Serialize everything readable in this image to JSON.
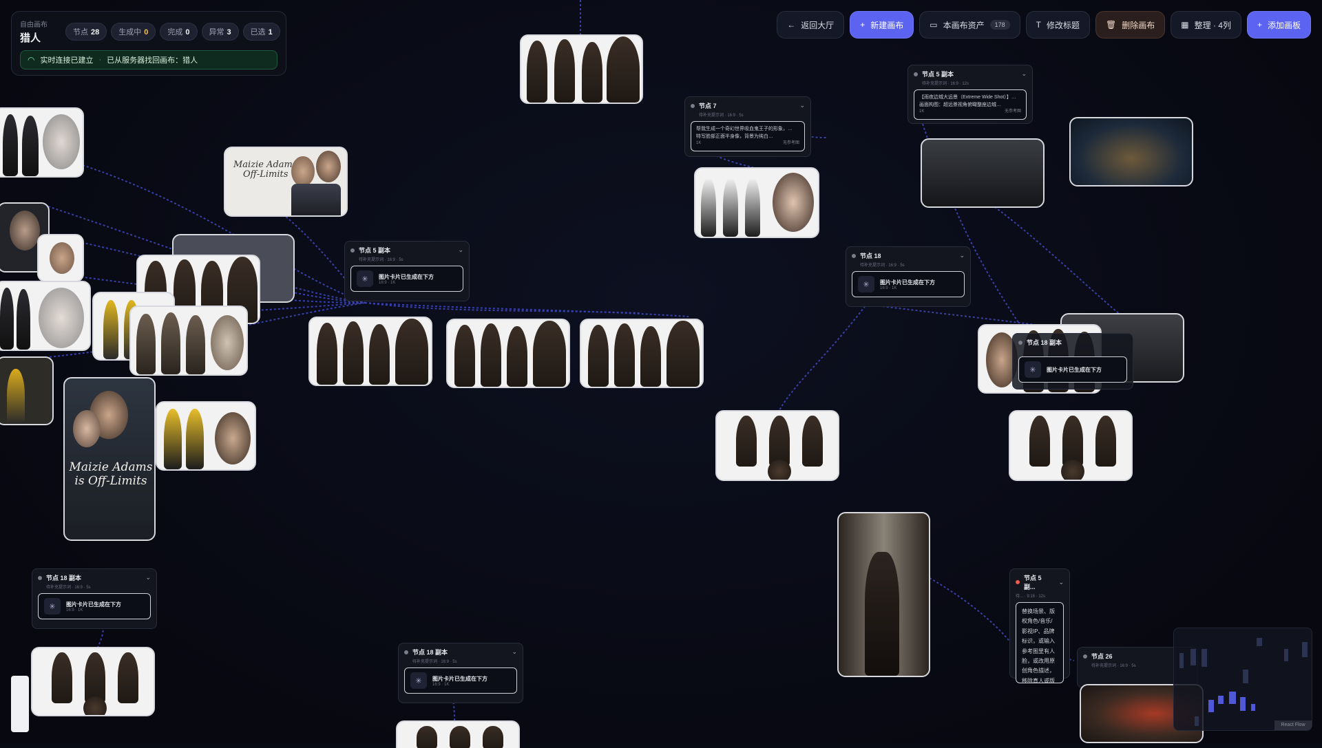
{
  "header": {
    "breadcrumb": "自由画布",
    "title": "猎人",
    "chips": [
      {
        "label": "节点",
        "value": "28"
      },
      {
        "label": "生成中",
        "value": "0"
      },
      {
        "label": "完成",
        "value": "0"
      },
      {
        "label": "异常",
        "value": "3"
      },
      {
        "label": "已选",
        "value": "1"
      }
    ],
    "status": {
      "connection": "实时连接已建立",
      "separator": "·",
      "message": "已从服务器找回画布：猎人"
    }
  },
  "toolbar": {
    "back_lobby": "返回大厅",
    "new_canvas": "新建画布",
    "assets": "本画布资产",
    "assets_count": "178",
    "edit_title": "修改标题",
    "delete_canvas": "删除画布",
    "arrange": "整理 · 4列",
    "add_board": "添加画板"
  },
  "nodes": {
    "n5copy_a": {
      "title": "节点 5 副本",
      "sub": "待补充提示词 · 16:9 · 5s",
      "card_title": "图片卡片已生成在下方",
      "card_sub": "16:9 · 1K"
    },
    "n7": {
      "title": "节点 7",
      "sub": "待补充提示词 · 16:9 · 5s",
      "text1": "帮我生成一个奇幻世界吸血鬼王子的形象，…",
      "text2": "特写脸部正面半身像，背景为纯白…",
      "tag1": "1K",
      "tag2": "无参考图"
    },
    "n5copy_b": {
      "title": "节点 5 副本",
      "sub": "待补充提示词 · 16:9 · 12s",
      "text1": "【雨夜边城大远景（Extreme Wide Shot）】…",
      "text2": "画面构图：超远景视角俯瞰整座边城…",
      "tag1": "1K",
      "tag2": "无参考图"
    },
    "n18": {
      "title": "节点 18",
      "sub": "待补充提示词 · 16:9 · 5s",
      "card_title": "图片卡片已生成在下方",
      "card_sub": "16:9 · 1K"
    },
    "n18_overlap": {
      "title": "节点 18 副本",
      "card_title": "图片卡片已生成在下方"
    },
    "n18copy_left": {
      "title": "节点 18 副本",
      "sub": "待补充提示词 · 16:9 · 5s",
      "card_title": "图片卡片已生成在下方",
      "card_sub": "16:9 · 1K"
    },
    "n18copy_mid": {
      "title": "节点 18 副本",
      "sub": "待补充提示词 · 16:9 · 5s",
      "card_title": "图片卡片已生成在下方",
      "card_sub": "16:9 · 1K"
    },
    "n5copy_c": {
      "title": "节点 5 副...",
      "sub": "待... · 9:16 · 12s",
      "vtext": "替换场景、版权角色/音乐/影视IP、品牌标识，或输入参考图里有人脸，或改用原创角色描述，移除真人或版权相关表述与参考图后重试。原…"
    },
    "n26": {
      "title": "节点 26",
      "sub": "待补充提示词 · 16:9 · 5s"
    }
  },
  "posters": {
    "title_line1": "Maizie Adams",
    "title_line2": "Off-Limits",
    "title_line1_b": "Maizie Adams",
    "title_line2_b": "is Off-Limits"
  },
  "flow_tag": "React Flow",
  "colors": {
    "accent": "#5b63f0",
    "success": "#6fe0a3",
    "warning": "#f2c14e",
    "error": "#f05a4a",
    "bg": "#080a14"
  }
}
